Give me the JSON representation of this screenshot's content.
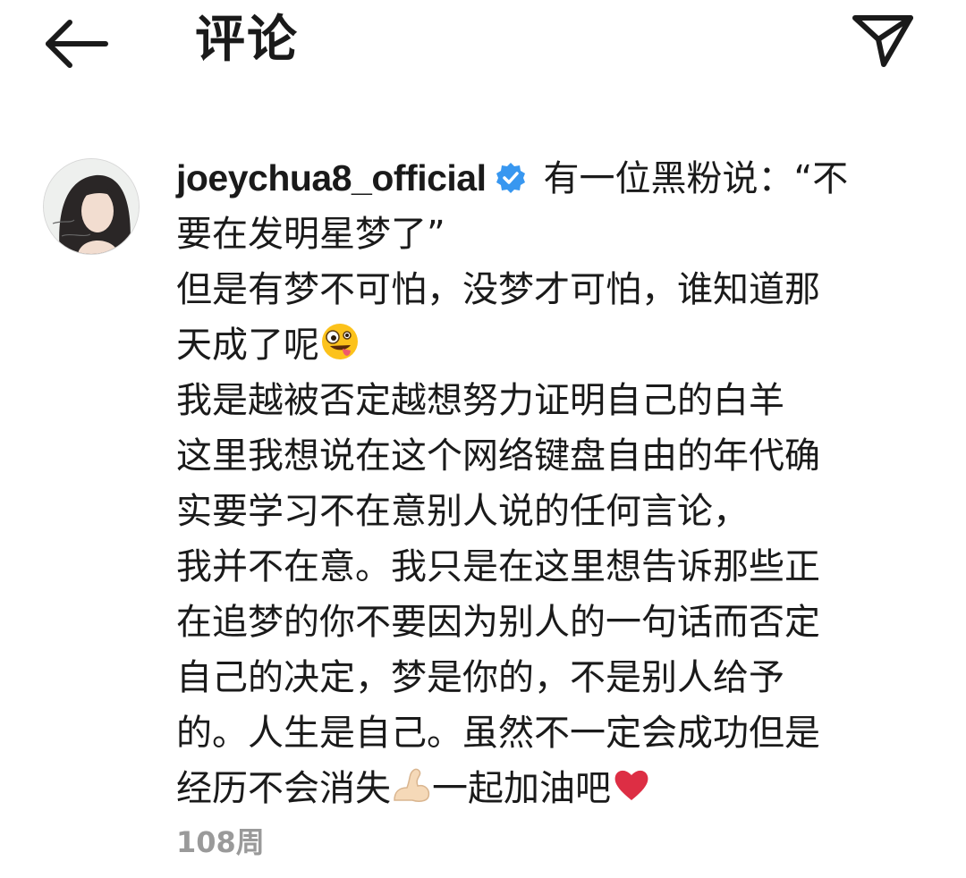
{
  "header": {
    "back_icon": "arrow-left-icon",
    "title": "评论",
    "share_icon": "send-icon"
  },
  "comment": {
    "avatar_icon": "profile-photo",
    "username": "joeychua8_official",
    "verified_icon": "verified-badge-icon",
    "verified_color": "#3897f0",
    "lines": {
      "l1": "有一位黑粉说：“不",
      "l2": "要在发明星梦了”",
      "l3": "但是有梦不可怕，没梦才可怕，谁知道那",
      "l4": "天成了呢",
      "l5": "我是越被否定越想努力证明自己的白羊",
      "l6": "这里我想说在这个网络键盘自由的年代确",
      "l7": "实要学习不在意别人说的任何言论，",
      "l8": "我并不在意。我只是在这里想告诉那些正",
      "l9": "在追梦的你不要因为别人的一句话而否定",
      "l10": "自己的决定，梦是你的，不是别人给予",
      "l11": "的。人生是自己。虽然不一定会成功但是",
      "l12a": "经历不会消失",
      "l12b": "一起加油吧"
    },
    "emojis": [
      "zany-face-emoji",
      "flexed-biceps-emoji",
      "red-heart-emoji"
    ],
    "meta": {
      "time": "108周"
    }
  }
}
